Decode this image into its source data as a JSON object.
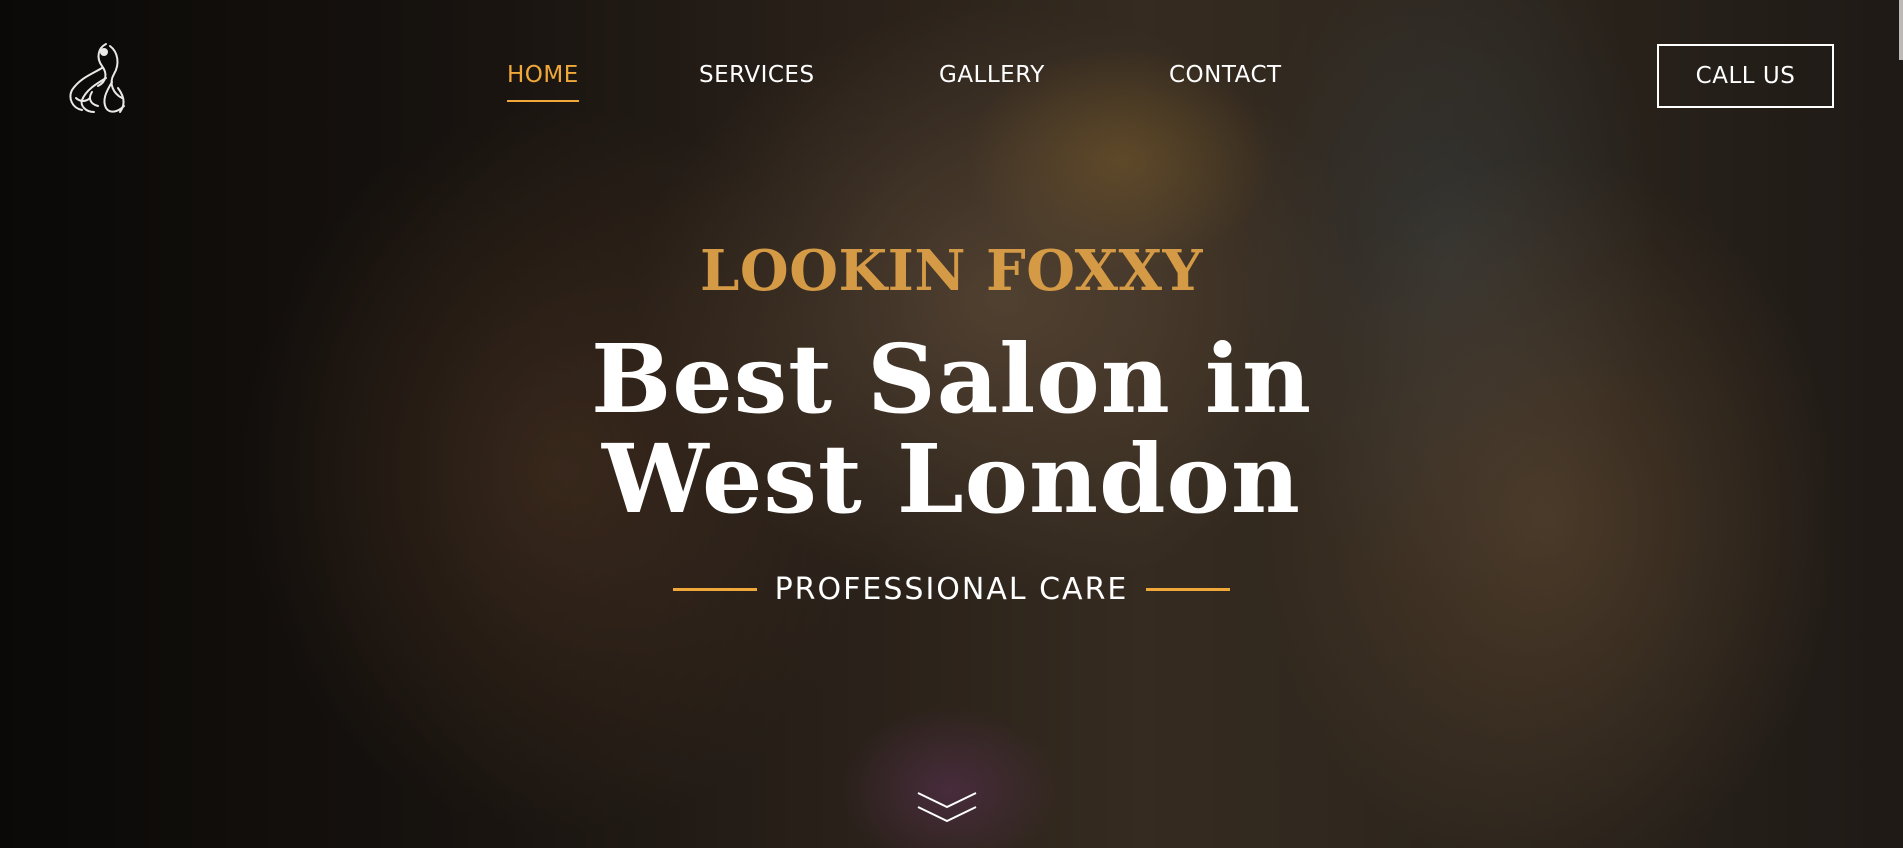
{
  "header": {
    "logo_icon": "woman-hair-logo-icon",
    "nav": {
      "home": "HOME",
      "services": "SERVICES",
      "gallery": "GALLERY",
      "contact": "CONTACT"
    },
    "active_nav": "HOME",
    "cta_label": "CALL US"
  },
  "hero": {
    "kicker": "LOOKIN FOXXY",
    "headline_line1": "Best Salon in",
    "headline_line2": "West London",
    "tagline": "PROFESSIONAL CARE",
    "scroll_icon": "double-chevron-down-icon"
  },
  "colors": {
    "accent": "#f0a83a",
    "kicker": "#d49a45",
    "text": "#ffffff"
  }
}
